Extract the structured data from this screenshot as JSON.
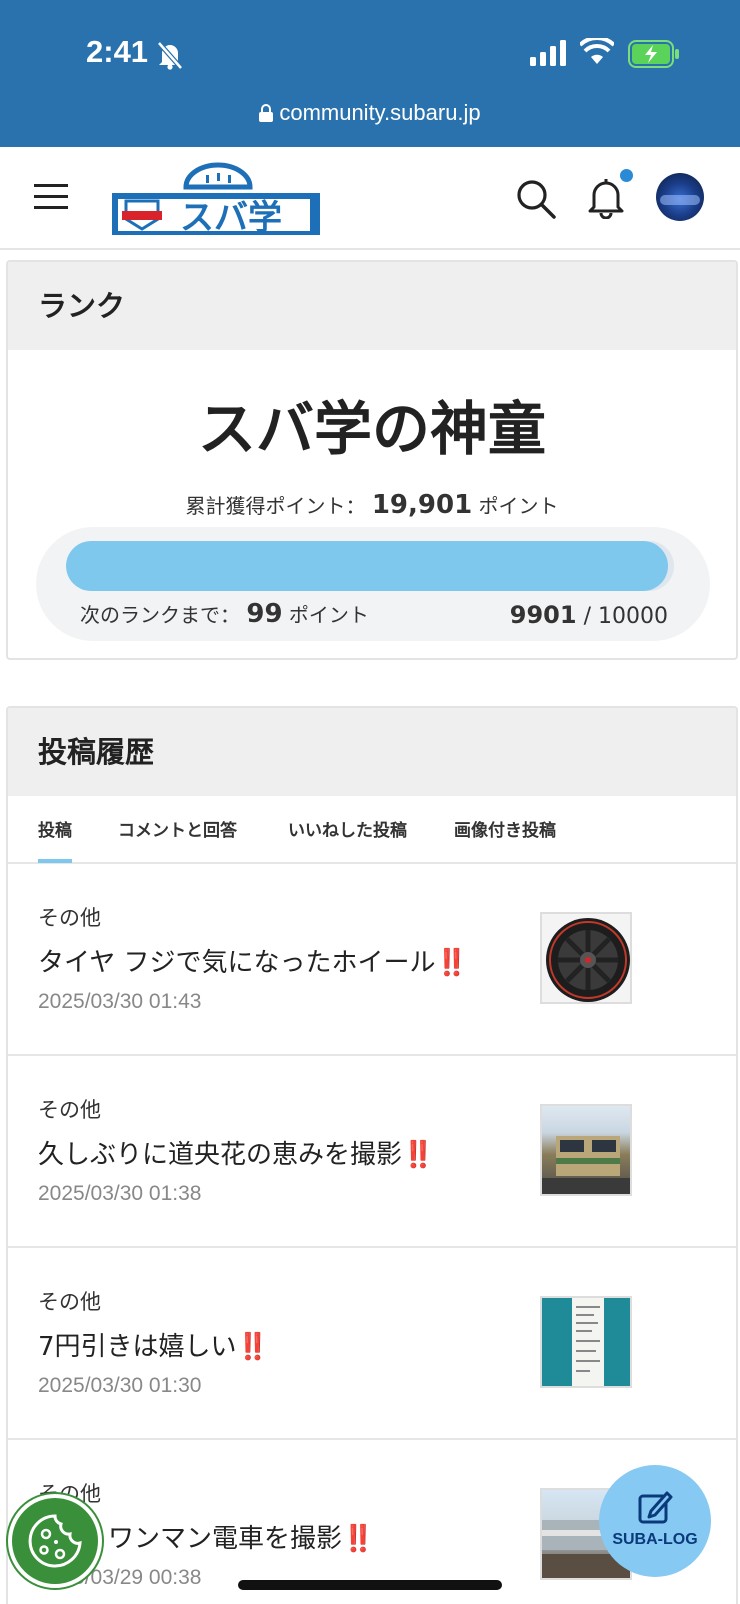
{
  "status_bar": {
    "time": "2:41",
    "url": "community.subaru.jp"
  },
  "header": {
    "logo_text": "スバ学"
  },
  "rank": {
    "section_title": "ランク",
    "rank_name": "スバ学の神童",
    "total_label": "累計獲得ポイント：",
    "total_points": "19,901",
    "points_unit": "ポイント",
    "next_label": "次のランクまで：",
    "next_points": "99",
    "current": "9901",
    "separator": "/",
    "max": "10000",
    "progress_fraction": 0.9901
  },
  "history": {
    "section_title": "投稿履歴",
    "tabs": [
      {
        "label": "投稿",
        "active": true
      },
      {
        "label": "コメントと回答",
        "active": false
      },
      {
        "label": "いいねした投稿",
        "active": false
      },
      {
        "label": "画像付き投稿",
        "active": false
      }
    ],
    "posts": [
      {
        "category": "その他",
        "title": "タイヤ フジで気になったホイール",
        "emoji": "‼️",
        "date": "2025/03/30 01:43"
      },
      {
        "category": "その他",
        "title": "久しぶりに道央花の恵みを撮影",
        "emoji": "‼️",
        "date": "2025/03/30 01:38"
      },
      {
        "category": "その他",
        "title": "7円引きは嬉しい",
        "emoji": "‼️",
        "date": "2025/03/30 01:30"
      },
      {
        "category": "その他",
        "title": "ワンマン電車を撮影",
        "emoji": "‼️",
        "date": "2025/03/29 00:38"
      }
    ]
  },
  "floating": {
    "suba_log_label": "SUBA-LOG"
  },
  "colors": {
    "header_blue": "#2a72ad",
    "progress": "#7ec8ee",
    "accent": "#e02020"
  }
}
